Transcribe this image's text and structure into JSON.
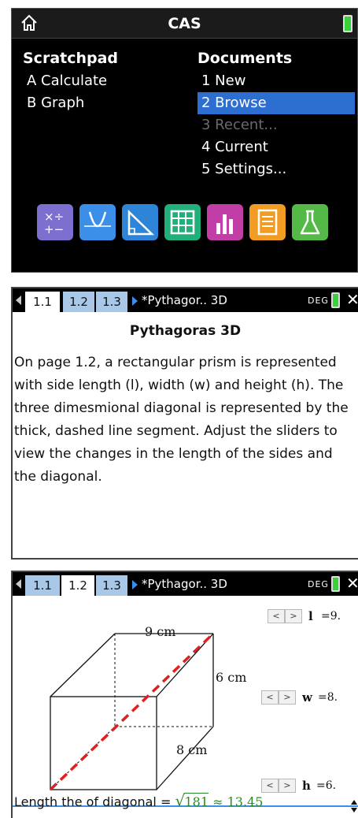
{
  "home": {
    "title": "CAS",
    "scratchpad": {
      "heading": "Scratchpad",
      "items": [
        "A  Calculate",
        "B  Graph"
      ]
    },
    "documents": {
      "heading": "Documents",
      "items": [
        "1  New",
        "2  Browse",
        "3  Recent...",
        "4  Current",
        "5  Settings..."
      ],
      "selected_index": 1,
      "disabled_index": 2
    },
    "apps": [
      {
        "icon": "calculator-icon",
        "color": "#7c6fcf"
      },
      {
        "icon": "graphs-icon",
        "color": "#3b8fe8"
      },
      {
        "icon": "geometry-icon",
        "color": "#2e84d6"
      },
      {
        "icon": "lists-spreadsheet-icon",
        "color": "#22b07a"
      },
      {
        "icon": "data-statistics-icon",
        "color": "#c03ea6"
      },
      {
        "icon": "notes-icon",
        "color": "#f39c24"
      },
      {
        "icon": "vernier-dataquest-icon",
        "color": "#55b948"
      }
    ]
  },
  "doc1": {
    "tabs": [
      "1.1",
      "1.2",
      "1.3"
    ],
    "active_tab": "1.1",
    "doc_name": "*Pythagor.. 3D",
    "angle_mode": "DEG",
    "title": "Pythagoras 3D",
    "body": "On page 1.2, a rectangular prism is represented with side length (l), width (w) and height (h). The three dimesmional diagonal is represented by the thick, dashed line segment. Adjust the sliders to view the changes in the length of the sides and the diagonal."
  },
  "doc2": {
    "tabs": [
      "1.1",
      "1.2",
      "1.3"
    ],
    "active_tab": "1.2",
    "doc_name": "*Pythagor.. 3D",
    "angle_mode": "DEG",
    "dims": {
      "length": "9 cm",
      "height": "6 cm",
      "width": "8 cm"
    },
    "sliders": [
      {
        "var": "l",
        "value": "=9."
      },
      {
        "var": "w",
        "value": "=8."
      },
      {
        "var": "h",
        "value": "=6."
      }
    ],
    "slider_left": "<",
    "slider_right": ">",
    "calc": {
      "label": "Length the of diagonal =",
      "radicand": "181",
      "approx": "≈ 13.45"
    },
    "colors": {
      "diagonal": "#e02020",
      "accent": "#3b8fe8",
      "result": "#2a8a2a"
    }
  }
}
